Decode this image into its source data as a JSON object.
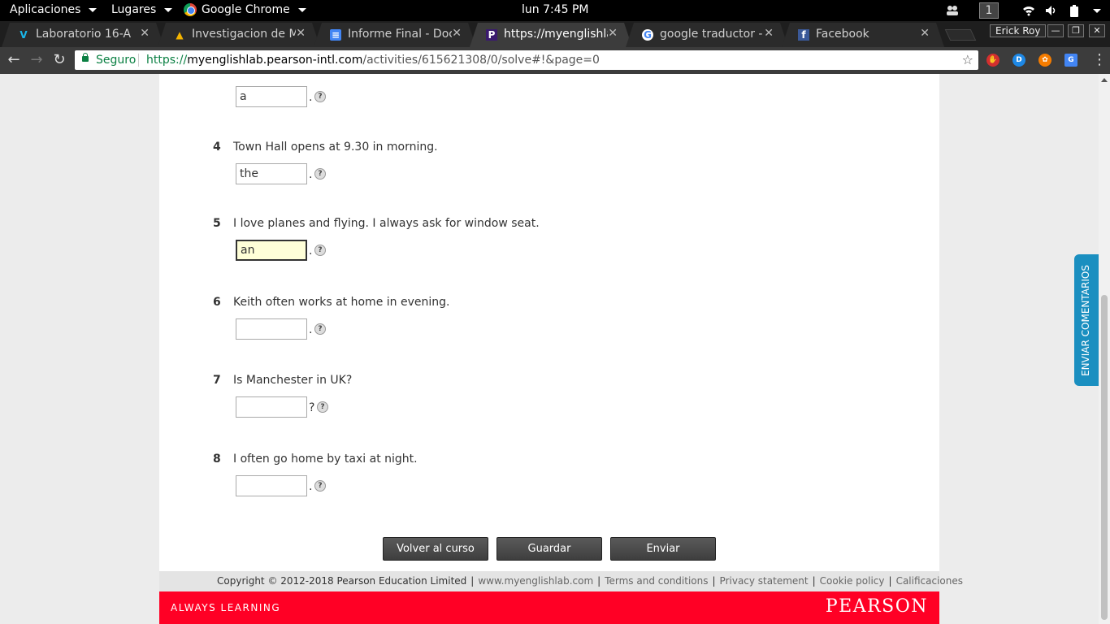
{
  "topbar": {
    "apps_label": "Aplicaciones",
    "places_label": "Lugares",
    "active_app_label": "Google Chrome",
    "clock": "lun  7:45 PM",
    "workspace": "1"
  },
  "tabs": [
    {
      "label": "Laboratorio 16-A",
      "favicon": "V",
      "icon": "vimeo-icon",
      "color": "#1ab7ea"
    },
    {
      "label": "Investigacion de Mer",
      "favicon": "▲",
      "icon": "google-drive-icon",
      "color": "#f4b400"
    },
    {
      "label": "Informe Final - Docu",
      "favicon": "≡",
      "icon": "google-docs-icon",
      "color": "#4285f4"
    },
    {
      "label": "https://myenglishlab",
      "favicon": "P",
      "icon": "pearson-icon",
      "color": "#ffffff"
    },
    {
      "label": "google traductor - B",
      "favicon": "G",
      "icon": "google-icon",
      "color": "#ffffff"
    },
    {
      "label": "Facebook",
      "favicon": "f",
      "icon": "facebook-icon",
      "color": "#3b5998"
    }
  ],
  "profile_name": "Erick Roy",
  "address": {
    "secure_label": "Seguro",
    "scheme": "https://",
    "host": "myenglishlab.pearson-intl.com",
    "path": "/activities/615621308/0/solve#!&page=0"
  },
  "questions": [
    {
      "num": "",
      "text": "",
      "answer": "a",
      "punct": "."
    },
    {
      "num": "4",
      "text": "Town Hall opens at 9.30 in morning.",
      "answer": "the",
      "punct": "."
    },
    {
      "num": "5",
      "text": "I love planes and flying. I always ask for window seat.",
      "answer": "an",
      "punct": "."
    },
    {
      "num": "6",
      "text": "Keith often works at home in evening.",
      "answer": "",
      "punct": "."
    },
    {
      "num": "7",
      "text": "Is Manchester in UK?",
      "answer": "",
      "punct": "?"
    },
    {
      "num": "8",
      "text": "I often go home by taxi at night.",
      "answer": "",
      "punct": "."
    }
  ],
  "help_glyph": "?",
  "buttons": {
    "back": "Volver al curso",
    "save": "Guardar",
    "submit": "Enviar"
  },
  "footer": {
    "copyright": "Copyright © 2012-2018 Pearson Education Limited",
    "site": "www.myenglishlab.com",
    "terms": "Terms and conditions",
    "privacy": "Privacy statement",
    "cookie": "Cookie policy",
    "grades": "Calificaciones"
  },
  "brand": {
    "tagline": "ALWAYS LEARNING",
    "logo_text": "PEARSON",
    "color": "#ff0025"
  },
  "feedback_label": "ENVIAR COMENTARIOS"
}
